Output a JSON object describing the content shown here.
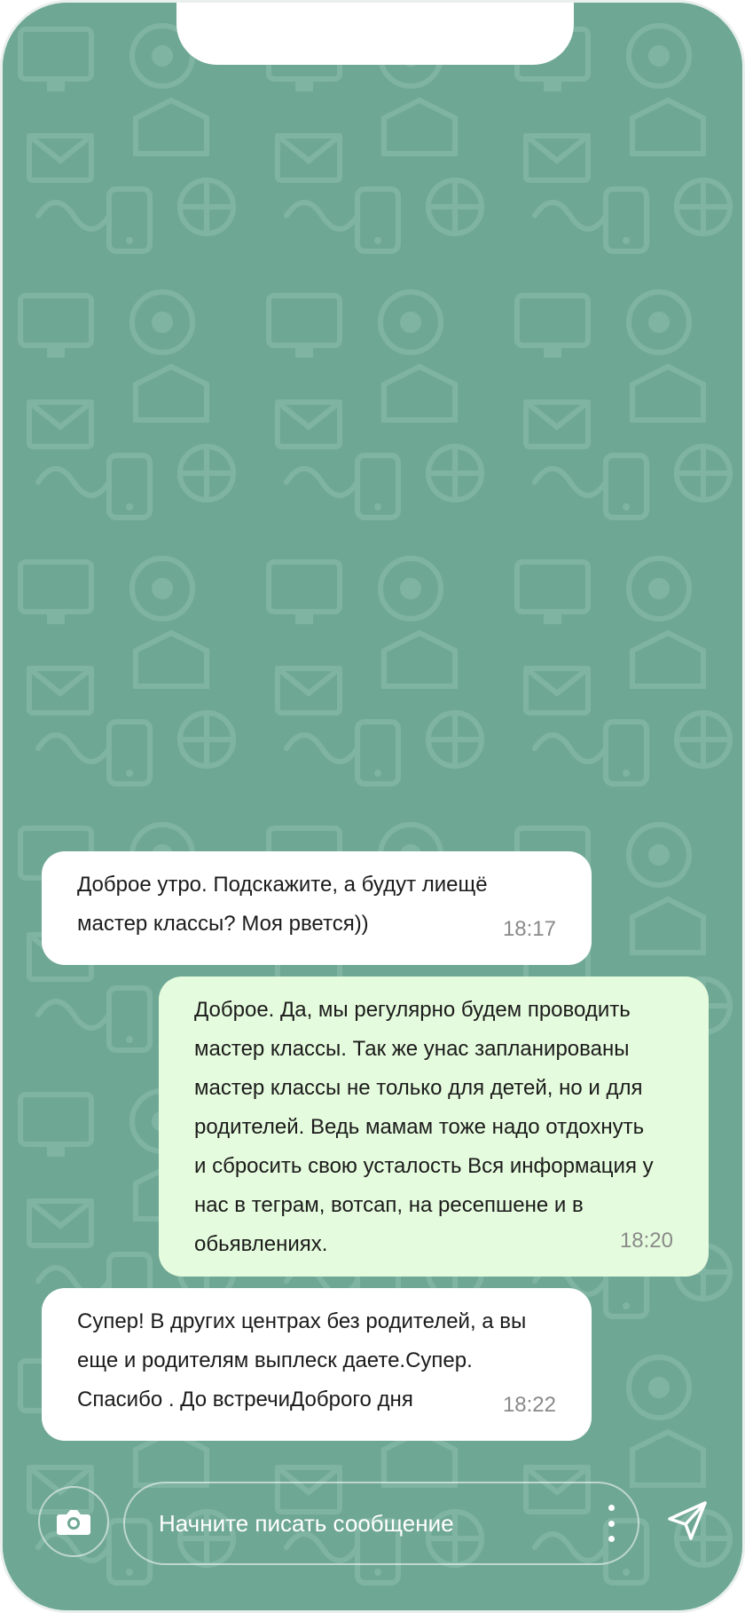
{
  "chat": {
    "messages": [
      {
        "direction": "incoming",
        "text": "Доброе утро. Подскажите, а будут лиещё\nмастер классы? Моя рвется))",
        "time": "18:17"
      },
      {
        "direction": "outgoing",
        "text": "Доброе. Да, мы регулярно будем проводить\nмастер классы. Так же унас запланированы\nмастер классы не только для детей, но и для\nродителей. Ведь мамам тоже надо отдохнуть\nи сбросить свою усталость Вся информация у\nнас в теграм, вотсап, на ресепшене и в\nобьявлениях.",
        "time": "18:20"
      },
      {
        "direction": "incoming",
        "text": "Супер! В других центрах без родителей, а вы\nеще и родителям выплеск даете.Супер.\nСпасибо . До встречиДоброго дня",
        "time": "18:22"
      }
    ]
  },
  "composer": {
    "placeholder": "Начните писать сообщение",
    "value": ""
  },
  "icons": {
    "camera": "camera-icon",
    "more": "more-vertical-icon",
    "send": "send-icon"
  },
  "colors": {
    "wallpaper": "#6fa795",
    "incoming_bubble": "#ffffff",
    "outgoing_bubble": "#e5fbdd",
    "timestamp": "#8a8a8a"
  }
}
